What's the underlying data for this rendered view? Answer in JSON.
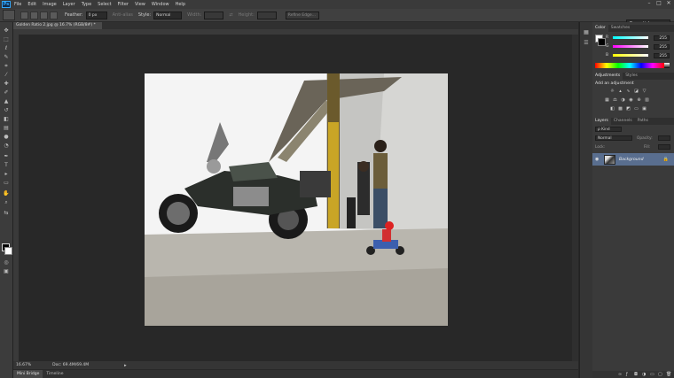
{
  "app": {
    "logo": "Ps"
  },
  "menu": [
    "File",
    "Edit",
    "Image",
    "Layer",
    "Type",
    "Select",
    "Filter",
    "View",
    "Window",
    "Help"
  ],
  "window_controls": [
    "–",
    "□",
    "✕"
  ],
  "options": {
    "feather_label": "Feather:",
    "feather_value": "0 px",
    "antialias_label": "Anti-alias",
    "style_label": "Style:",
    "style_value": "Normal",
    "width_label": "Width:",
    "height_label": "Height:",
    "refine_label": "Refine Edge...",
    "workspace": "Essentials"
  },
  "document": {
    "tab_title": "Golden Ratio 2.jpg @ 16.7% (RGB/8#) *",
    "tab_close": "×",
    "zoom": "16.67%",
    "doc_size": "Doc: 69.4M/69.4M",
    "status_arrow": "▸"
  },
  "bottom_tabs": [
    "Mini Bridge",
    "Timeline"
  ],
  "panels": {
    "color": {
      "tabs": [
        "Color",
        "Swatches"
      ],
      "channels": [
        {
          "name": "R",
          "value": "255",
          "color": "#ff3b3b"
        },
        {
          "name": "G",
          "value": "255",
          "color": "#e041e0"
        },
        {
          "name": "B",
          "value": "255",
          "color": "#f0e040"
        }
      ]
    },
    "adjustments": {
      "tabs": [
        "Adjustments",
        "Styles"
      ],
      "title": "Add an adjustment"
    },
    "layers": {
      "tabs": [
        "Layers",
        "Channels",
        "Paths"
      ],
      "kind": "ρ Kind",
      "blend": "Normal",
      "opacity_label": "Opacity:",
      "lock_label": "Lock:",
      "fill_label": "Fill:",
      "layer_name": "Background"
    }
  },
  "colors": {
    "accent": "#31a8ff",
    "layer_selected": "#596e8f"
  }
}
